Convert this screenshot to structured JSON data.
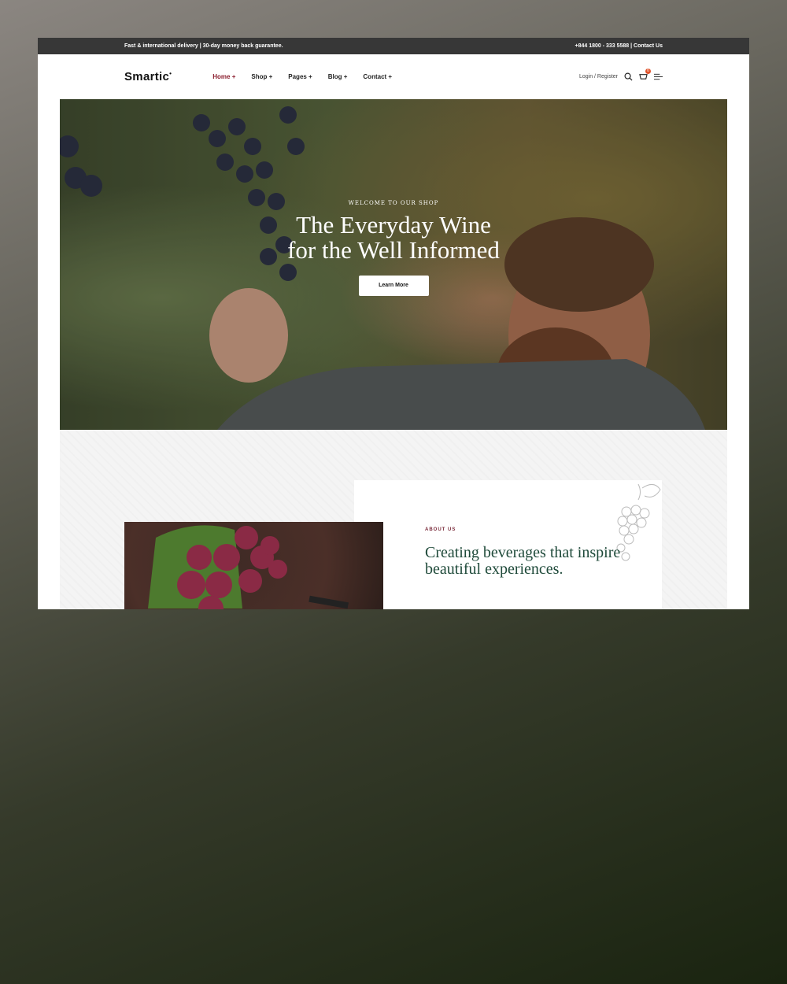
{
  "topbar": {
    "left": "Fast & international delivery | 30-day money back guarantee.",
    "right": "+844 1800 - 333 5588 | Contact Us"
  },
  "header": {
    "logo": "Smartic",
    "nav": [
      {
        "label": "Home +"
      },
      {
        "label": "Shop +"
      },
      {
        "label": "Pages +"
      },
      {
        "label": "Blog +"
      },
      {
        "label": "Contact +"
      }
    ],
    "login": "Login / Register",
    "cart_count": "0"
  },
  "hero": {
    "eyebrow": "WELCOME TO OUR SHOP",
    "title": "The Everyday Wine for the Well Informed",
    "button": "Learn More"
  },
  "about": {
    "label": "ABOUT US",
    "title": "Creating beverages that inspire beautiful experiences."
  },
  "colors": {
    "accent": "#8a1c2c",
    "heading_green": "#1f4a3a",
    "topbar": "#373737",
    "badge": "#e0522b"
  }
}
